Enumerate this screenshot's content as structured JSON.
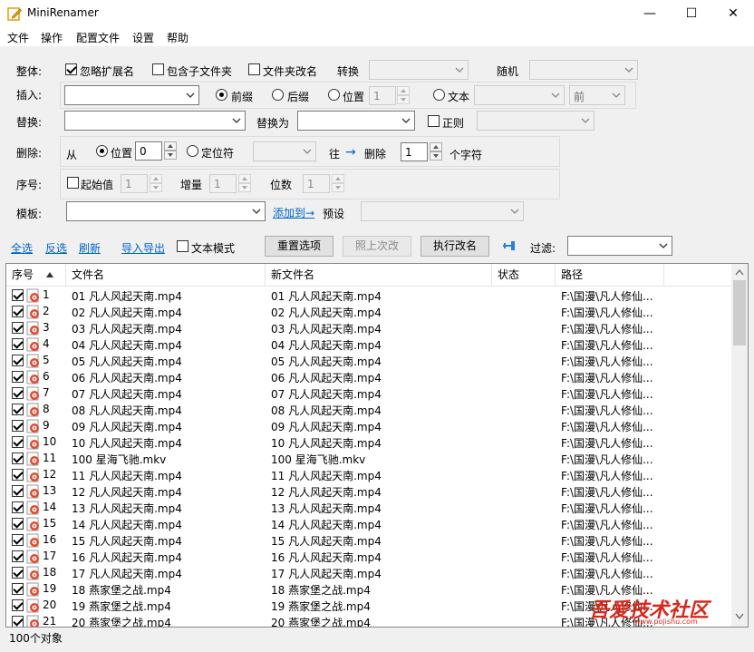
{
  "window": {
    "title": "MiniRenamer",
    "minimize": "—",
    "maximize": "☐",
    "close": "✕"
  },
  "menu": [
    "文件",
    "操作",
    "配置文件",
    "设置",
    "帮助"
  ],
  "whole": {
    "label": "整体:",
    "ignore_ext": "忽略扩展名",
    "include_sub": "包含子文件夹",
    "rename_folder": "文件夹改名",
    "convert": "转换",
    "random": "随机"
  },
  "insert": {
    "label": "插入:",
    "prefix": "前缀",
    "suffix": "后缀",
    "position": "位置",
    "position_value": "1",
    "text": "文本",
    "text_dir": "前"
  },
  "replace": {
    "label": "替换:",
    "replace_with": "替换为",
    "regex": "正则"
  },
  "delete": {
    "label": "删除:",
    "from": "从",
    "position": "位置",
    "position_value": "0",
    "locator": "定位符",
    "to": "往",
    "arrow": "→",
    "delete_word": "删除",
    "count": "1",
    "unit": "个字符"
  },
  "sequence": {
    "label": "序号:",
    "start": "起始值",
    "start_value": "1",
    "increment": "增量",
    "increment_value": "1",
    "digits": "位数",
    "digits_value": "1"
  },
  "template": {
    "label": "模板:",
    "add_to": "添加到→",
    "preset": "预设"
  },
  "toolbar": {
    "select_all": "全选",
    "invert": "反选",
    "refresh": "刷新",
    "import_export": "导入导出",
    "text_mode": "文本模式",
    "reset": "重置选项",
    "last_time": "照上次改",
    "execute": "执行改名",
    "filter": "过滤:"
  },
  "columns": [
    "序号",
    "文件名",
    "新文件名",
    "状态",
    "路径"
  ],
  "rows": [
    {
      "n": "1",
      "name": "01 凡人风起天南.mp4",
      "new": "01 凡人风起天南.mp4",
      "path": "F:\\国漫\\凡人修仙..."
    },
    {
      "n": "2",
      "name": "02 凡人风起天南.mp4",
      "new": "02 凡人风起天南.mp4",
      "path": "F:\\国漫\\凡人修仙..."
    },
    {
      "n": "3",
      "name": "03 凡人风起天南.mp4",
      "new": "03 凡人风起天南.mp4",
      "path": "F:\\国漫\\凡人修仙..."
    },
    {
      "n": "4",
      "name": "04 凡人风起天南.mp4",
      "new": "04 凡人风起天南.mp4",
      "path": "F:\\国漫\\凡人修仙..."
    },
    {
      "n": "5",
      "name": "05 凡人风起天南.mp4",
      "new": "05 凡人风起天南.mp4",
      "path": "F:\\国漫\\凡人修仙..."
    },
    {
      "n": "6",
      "name": "06 凡人风起天南.mp4",
      "new": "06 凡人风起天南.mp4",
      "path": "F:\\国漫\\凡人修仙..."
    },
    {
      "n": "7",
      "name": "07 凡人风起天南.mp4",
      "new": "07 凡人风起天南.mp4",
      "path": "F:\\国漫\\凡人修仙..."
    },
    {
      "n": "8",
      "name": "08 凡人风起天南.mp4",
      "new": "08 凡人风起天南.mp4",
      "path": "F:\\国漫\\凡人修仙..."
    },
    {
      "n": "9",
      "name": "09 凡人风起天南.mp4",
      "new": "09 凡人风起天南.mp4",
      "path": "F:\\国漫\\凡人修仙..."
    },
    {
      "n": "10",
      "name": "10 凡人风起天南.mp4",
      "new": "10 凡人风起天南.mp4",
      "path": "F:\\国漫\\凡人修仙..."
    },
    {
      "n": "11",
      "name": "100 星海飞驰.mkv",
      "new": "100 星海飞驰.mkv",
      "path": "F:\\国漫\\凡人修仙..."
    },
    {
      "n": "12",
      "name": "11 凡人风起天南.mp4",
      "new": "11 凡人风起天南.mp4",
      "path": "F:\\国漫\\凡人修仙..."
    },
    {
      "n": "13",
      "name": "12 凡人风起天南.mp4",
      "new": "12 凡人风起天南.mp4",
      "path": "F:\\国漫\\凡人修仙..."
    },
    {
      "n": "14",
      "name": "13 凡人风起天南.mp4",
      "new": "13 凡人风起天南.mp4",
      "path": "F:\\国漫\\凡人修仙..."
    },
    {
      "n": "15",
      "name": "14 凡人风起天南.mp4",
      "new": "14 凡人风起天南.mp4",
      "path": "F:\\国漫\\凡人修仙..."
    },
    {
      "n": "16",
      "name": "15 凡人风起天南.mp4",
      "new": "15 凡人风起天南.mp4",
      "path": "F:\\国漫\\凡人修仙..."
    },
    {
      "n": "17",
      "name": "16 凡人风起天南.mp4",
      "new": "16 凡人风起天南.mp4",
      "path": "F:\\国漫\\凡人修仙..."
    },
    {
      "n": "18",
      "name": "17 凡人风起天南.mp4",
      "new": "17 凡人风起天南.mp4",
      "path": "F:\\国漫\\凡人修仙..."
    },
    {
      "n": "19",
      "name": "18 燕家堡之战.mp4",
      "new": "18 燕家堡之战.mp4",
      "path": "F:\\国漫\\凡人修仙..."
    },
    {
      "n": "20",
      "name": "19 燕家堡之战.mp4",
      "new": "19 燕家堡之战.mp4",
      "path": "F:\\国漫\\凡人修仙..."
    },
    {
      "n": "21",
      "name": "20 燕家堡之战.mp4",
      "new": "20 燕家堡之战.mp4",
      "path": "F:\\国漫\\凡人修仙..."
    }
  ],
  "status": {
    "count": "100个对象"
  },
  "watermark": {
    "text": "吾爱技术社区",
    "url": "www.pojishu.com"
  }
}
